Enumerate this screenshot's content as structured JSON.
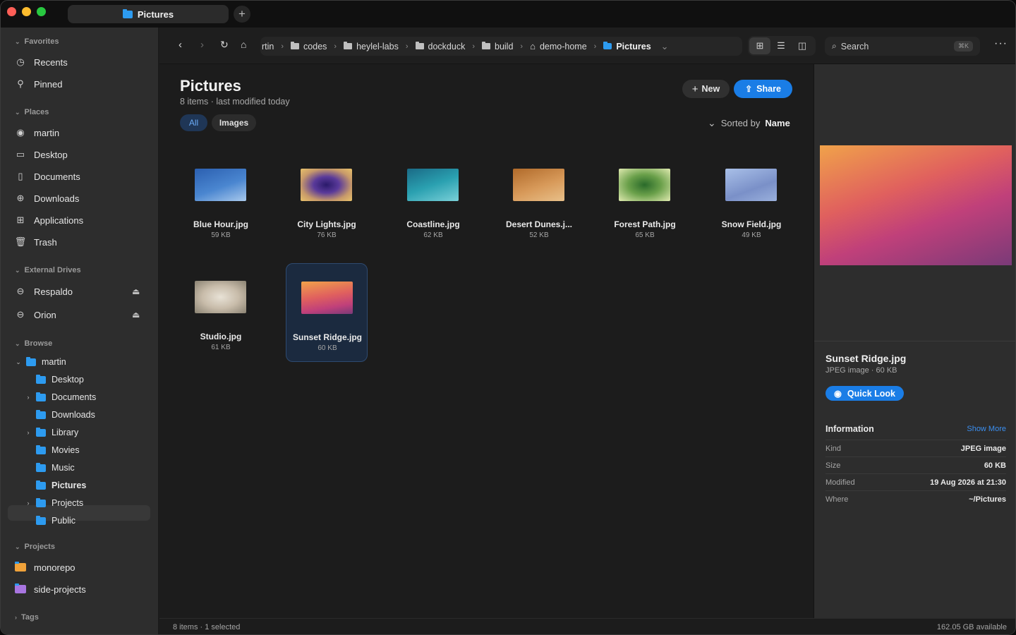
{
  "window": {
    "tab_title": "Pictures",
    "new_tab": "+"
  },
  "colors": {
    "accent": "#1a7de6",
    "folder": "#2d9bf0",
    "close": "#ff5f57",
    "minimize": "#febc2e",
    "zoom": "#28c840",
    "project_orange": "#f0a23a",
    "project_purple": "#a875e0"
  },
  "sidebar": {
    "favorites_label": "Favorites",
    "favorites": [
      {
        "label": "Recents",
        "icon": "clock-icon"
      },
      {
        "label": "Pinned",
        "icon": "pin-icon"
      }
    ],
    "places_label": "Places",
    "places": [
      {
        "label": "martin",
        "icon": "user-icon"
      },
      {
        "label": "Desktop",
        "icon": "desktop-icon"
      },
      {
        "label": "Documents",
        "icon": "document-icon"
      },
      {
        "label": "Downloads",
        "icon": "download-icon"
      },
      {
        "label": "Applications",
        "icon": "apps-grid-icon"
      },
      {
        "label": "Trash",
        "icon": "trash-icon"
      }
    ],
    "drives_label": "External Drives",
    "drives": [
      {
        "label": "Respaldo",
        "icon": "drive-icon"
      },
      {
        "label": "Orion",
        "icon": "drive-icon"
      }
    ],
    "browse_label": "Browse",
    "tree_root": "martin",
    "tree": [
      {
        "label": "Desktop",
        "expandable": false
      },
      {
        "label": "Documents",
        "expandable": true
      },
      {
        "label": "Downloads",
        "expandable": false
      },
      {
        "label": "Library",
        "expandable": true
      },
      {
        "label": "Movies",
        "expandable": false
      },
      {
        "label": "Music",
        "expandable": false
      },
      {
        "label": "Pictures",
        "expandable": false,
        "selected": true
      },
      {
        "label": "Projects",
        "expandable": true
      },
      {
        "label": "Public",
        "expandable": false
      }
    ],
    "projects_label": "Projects",
    "projects": [
      {
        "label": "monorepo"
      },
      {
        "label": "side-projects"
      }
    ],
    "tags_label": "Tags"
  },
  "toolbar": {
    "breadcrumbs": [
      "rtin",
      "codes",
      "heylel-labs",
      "dockduck",
      "build",
      "demo-home",
      "Pictures"
    ],
    "search_placeholder": "Search",
    "search_shortcut": "⌘K"
  },
  "main": {
    "title": "Pictures",
    "subtitle": "8 items · last modified today",
    "new_label": "New",
    "share_label": "Share",
    "filters": [
      "All",
      "Images"
    ],
    "sort_prefix": "Sorted by",
    "sort_value": "Name",
    "files": [
      {
        "name": "Blue Hour.jpg",
        "size": "59 KB",
        "gradient": "linear-gradient(160deg,#2b5fb0 0%,#4a86d0 55%,#a9c9ec 100%)"
      },
      {
        "name": "City Lights.jpg",
        "size": "76 KB",
        "gradient": "radial-gradient(ellipse at center,#2a1a6a 0%,#5a3a9a 35%,#c89a6a 70%,#e8c26a 100%)"
      },
      {
        "name": "Coastline.jpg",
        "size": "62 KB",
        "gradient": "linear-gradient(160deg,#1a6a86 0%,#2aa0b0 50%,#7ad0d8 100%)"
      },
      {
        "name": "Desert Dunes.j...",
        "size": "52 KB",
        "gradient": "linear-gradient(160deg,#b06a2a 0%,#d89a5a 55%,#e8c08a 100%)"
      },
      {
        "name": "Forest Path.jpg",
        "size": "65 KB",
        "gradient": "radial-gradient(ellipse at center,#2a6a2a 0%,#6aa04a 45%,#e0eab0 100%)"
      },
      {
        "name": "Snow Field.jpg",
        "size": "49 KB",
        "gradient": "linear-gradient(160deg,#a9c0e8 0%,#7a90c8 60%,#9ab0dc 100%)"
      },
      {
        "name": "Studio.jpg",
        "size": "61 KB",
        "gradient": "radial-gradient(ellipse at center,#e8e2d6 0%,#c8bcaa 50%,#8a8272 100%)"
      },
      {
        "name": "Sunset Ridge.jpg",
        "size": "60 KB",
        "gradient": "linear-gradient(170deg,#f0a24a 0%,#e0605e 45%,#c0407a 75%,#7a3a78 100%)",
        "selected": true
      }
    ]
  },
  "preview": {
    "name": "Sunset Ridge.jpg",
    "kind_line": "JPEG image · 60 KB",
    "quick_look": "Quick Look",
    "info_title": "Information",
    "show_more": "Show More",
    "info": [
      {
        "k": "Kind",
        "v": "JPEG image"
      },
      {
        "k": "Size",
        "v": "60 KB"
      },
      {
        "k": "Modified",
        "v": "19 Aug 2026 at 21:30"
      },
      {
        "k": "Where",
        "v": "~/Pictures"
      }
    ]
  },
  "status": {
    "left": "8 items · 1 selected",
    "right": "162.05 GB available"
  }
}
